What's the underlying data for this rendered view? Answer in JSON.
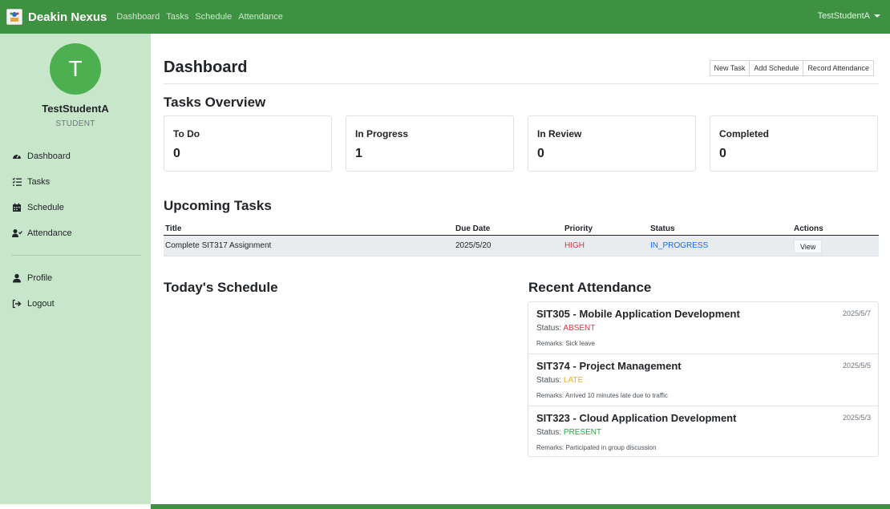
{
  "navbar": {
    "brand": "Deakin Nexus",
    "links": [
      "Dashboard",
      "Tasks",
      "Schedule",
      "Attendance"
    ],
    "user": "TestStudentA"
  },
  "sidebar": {
    "avatar_letter": "T",
    "username": "TestStudentA",
    "role": "STUDENT",
    "items": [
      {
        "label": "Dashboard",
        "icon": "tachometer-icon"
      },
      {
        "label": "Tasks",
        "icon": "tasks-icon"
      },
      {
        "label": "Schedule",
        "icon": "calendar-icon"
      },
      {
        "label": "Attendance",
        "icon": "user-check-icon"
      }
    ],
    "secondary_items": [
      {
        "label": "Profile",
        "icon": "user-icon"
      },
      {
        "label": "Logout",
        "icon": "sign-out-icon"
      }
    ]
  },
  "main": {
    "title": "Dashboard",
    "actions": [
      "New Task",
      "Add Schedule",
      "Record Attendance"
    ],
    "tasks_overview": {
      "heading": "Tasks Overview",
      "cards": [
        {
          "label": "To Do",
          "value": "0"
        },
        {
          "label": "In Progress",
          "value": "1"
        },
        {
          "label": "In Review",
          "value": "0"
        },
        {
          "label": "Completed",
          "value": "0"
        }
      ]
    },
    "upcoming": {
      "heading": "Upcoming Tasks",
      "columns": [
        "Title",
        "Due Date",
        "Priority",
        "Status",
        "Actions"
      ],
      "rows": [
        {
          "title": "Complete SIT317 Assignment",
          "due": "2025/5/20",
          "priority": "HIGH",
          "status": "IN_PROGRESS",
          "action": "View"
        }
      ]
    },
    "schedule": {
      "heading": "Today's Schedule"
    },
    "attendance": {
      "heading": "Recent Attendance",
      "status_prefix": "Status: ",
      "remarks_prefix": "Remarks: ",
      "items": [
        {
          "course": "SIT305 - Mobile Application Development",
          "date": "2025/5/7",
          "status": "ABSENT",
          "remarks": "Sick leave"
        },
        {
          "course": "SIT374 - Project Management",
          "date": "2025/5/5",
          "status": "LATE",
          "remarks": "Arrived 10 minutes late due to traffic"
        },
        {
          "course": "SIT323 - Cloud Application Development",
          "date": "2025/5/3",
          "status": "PRESENT",
          "remarks": "Participated in group discussion"
        }
      ]
    }
  },
  "colors": {
    "brand_green": "#3d9140",
    "sidebar_bg": "#c8e6c9",
    "avatar_bg": "#4caf50",
    "priority_high": "#dc3545",
    "status_in_progress": "#0d6efd",
    "status_absent": "#dc3545",
    "status_late": "#f0ad1a",
    "status_present": "#28a745"
  }
}
